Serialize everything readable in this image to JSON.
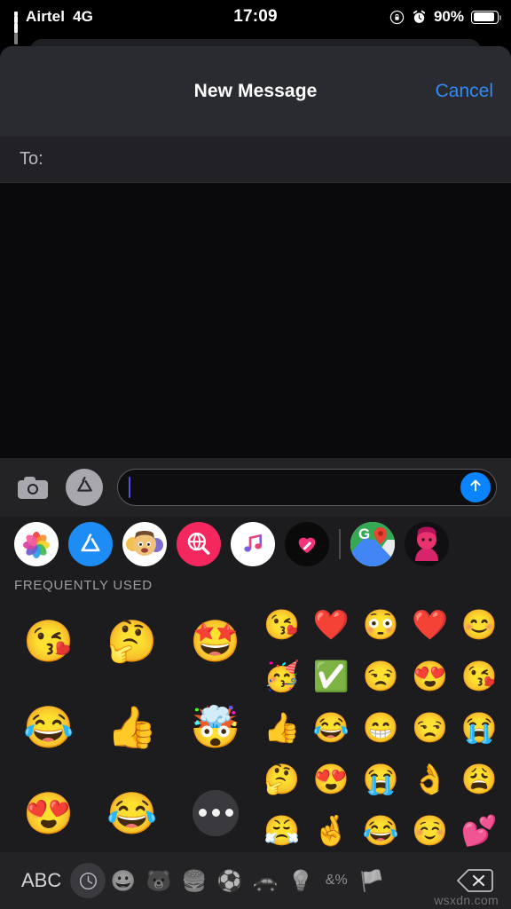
{
  "status_bar": {
    "carrier": "Airtel",
    "network": "4G",
    "time": "17:09",
    "battery_percent": "90%",
    "icons": {
      "signal": "signal-bars-icon",
      "rotation_lock": "rotation-lock-icon",
      "alarm": "alarm-clock-icon",
      "battery": "battery-icon"
    }
  },
  "header": {
    "title": "New Message",
    "cancel_label": "Cancel",
    "accent_color": "#2f8bf5"
  },
  "recipient_field": {
    "label": "To:",
    "value": "",
    "placeholder": ""
  },
  "compose_bar": {
    "camera_icon": "camera-icon",
    "appstore_icon": "app-store-icon",
    "message_value": "",
    "message_placeholder": "",
    "send_icon": "send-arrow-up-icon",
    "send_color": "#0a84ff"
  },
  "app_drawer": {
    "apps": [
      {
        "name": "photos-app",
        "label": "Photos"
      },
      {
        "name": "app-store-app",
        "label": "App Store"
      },
      {
        "name": "memoji-stickers-app",
        "label": "Memoji Stickers"
      },
      {
        "name": "images-app",
        "label": "#images"
      },
      {
        "name": "apple-music-app",
        "label": "Music"
      },
      {
        "name": "digital-touch-app",
        "label": "Digital Touch"
      },
      {
        "name": "google-maps-app",
        "label": "Google Maps"
      },
      {
        "name": "avatar-app",
        "label": "Avatar"
      }
    ]
  },
  "emoji_panel": {
    "section_title": "FREQUENTLY USED",
    "memoji": [
      {
        "glyph": "😘",
        "name": "memoji-kiss-heart"
      },
      {
        "glyph": "🤔",
        "name": "memoji-thinking"
      },
      {
        "glyph": "🤩",
        "name": "memoji-star-struck"
      },
      {
        "glyph": "😂",
        "name": "memoji-laughing-tears"
      },
      {
        "glyph": "👍",
        "name": "memoji-thumbs-up"
      },
      {
        "glyph": "🤯",
        "name": "memoji-mind-blown"
      },
      {
        "glyph": "😍",
        "name": "memoji-heart-eyes"
      },
      {
        "glyph": "😂",
        "name": "memoji-laughing-tears-2"
      }
    ],
    "more_label": "•••",
    "emoji": [
      {
        "glyph": "😘",
        "name": "emoji-face-blowing-a-kiss"
      },
      {
        "glyph": "❤️",
        "name": "emoji-red-heart"
      },
      {
        "glyph": "😳",
        "name": "emoji-flushed-face"
      },
      {
        "glyph": "❤️",
        "name": "emoji-red-heart-2"
      },
      {
        "glyph": "😊",
        "name": "emoji-smiling-face"
      },
      {
        "glyph": "🥳",
        "name": "emoji-partying-face"
      },
      {
        "glyph": "✅",
        "name": "emoji-check-mark-button"
      },
      {
        "glyph": "😒",
        "name": "emoji-unamused-face"
      },
      {
        "glyph": "😍",
        "name": "emoji-heart-eyes"
      },
      {
        "glyph": "😘",
        "name": "emoji-face-blowing-a-kiss-2"
      },
      {
        "glyph": "👍",
        "name": "emoji-thumbs-up"
      },
      {
        "glyph": "😂",
        "name": "emoji-tears-of-joy"
      },
      {
        "glyph": "😁",
        "name": "emoji-beaming-face"
      },
      {
        "glyph": "😒",
        "name": "emoji-unamused-face-2"
      },
      {
        "glyph": "😭",
        "name": "emoji-loudly-crying-face"
      },
      {
        "glyph": "🤔",
        "name": "emoji-thinking-face"
      },
      {
        "glyph": "😍",
        "name": "emoji-heart-eyes-2"
      },
      {
        "glyph": "😭",
        "name": "emoji-loudly-crying-face-2"
      },
      {
        "glyph": "👌",
        "name": "emoji-ok-hand"
      },
      {
        "glyph": "😩",
        "name": "emoji-weary-face"
      },
      {
        "glyph": "😤",
        "name": "emoji-face-with-steam"
      },
      {
        "glyph": "🤞",
        "name": "emoji-crossed-fingers"
      },
      {
        "glyph": "😂",
        "name": "emoji-tears-of-joy-2"
      },
      {
        "glyph": "☺️",
        "name": "emoji-smiling-face-relaxed"
      },
      {
        "glyph": "💕",
        "name": "emoji-two-hearts"
      }
    ]
  },
  "keyboard_toolbar": {
    "abc_label": "ABC",
    "categories": [
      {
        "glyph": "🕒",
        "name": "category-recents",
        "selected": true
      },
      {
        "glyph": "😀",
        "name": "category-smileys",
        "selected": false
      },
      {
        "glyph": "🐻",
        "name": "category-animals",
        "selected": false
      },
      {
        "glyph": "🍔",
        "name": "category-food",
        "selected": false
      },
      {
        "glyph": "⚽",
        "name": "category-activities",
        "selected": false
      },
      {
        "glyph": "🚗",
        "name": "category-travel",
        "selected": false
      },
      {
        "glyph": "💡",
        "name": "category-objects",
        "selected": false
      },
      {
        "glyph": "&%",
        "name": "category-symbols",
        "selected": false
      },
      {
        "glyph": "🏳️",
        "name": "category-flags",
        "selected": false
      }
    ],
    "delete_icon": "delete-backspace-icon"
  },
  "watermark": {
    "text": "wsxdn.com"
  }
}
